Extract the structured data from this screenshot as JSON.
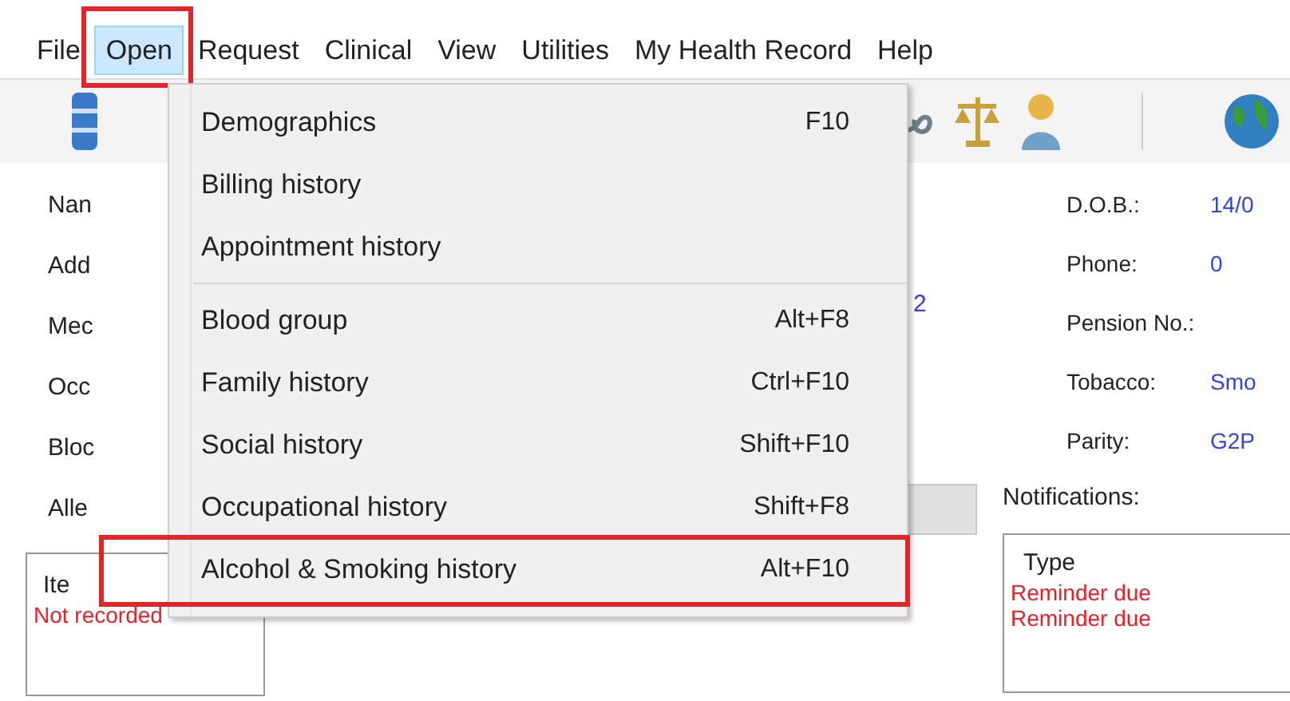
{
  "menu_bar": [
    {
      "label": "File",
      "selected": false,
      "highlighted": false
    },
    {
      "label": "Open",
      "selected": true,
      "highlighted": true
    },
    {
      "label": "Request",
      "selected": false,
      "highlighted": false
    },
    {
      "label": "Clinical",
      "selected": false,
      "highlighted": false
    },
    {
      "label": "View",
      "selected": false,
      "highlighted": false
    },
    {
      "label": "Utilities",
      "selected": false,
      "highlighted": false
    },
    {
      "label": "My Health Record",
      "selected": false,
      "highlighted": false
    },
    {
      "label": "Help",
      "selected": false,
      "highlighted": false
    }
  ],
  "open_menu": [
    {
      "kind": "item",
      "label": "Demographics",
      "shortcut": "F10",
      "highlighted": false
    },
    {
      "kind": "item",
      "label": "Billing history",
      "highlighted": false
    },
    {
      "kind": "item",
      "label": "Appointment history",
      "highlighted": false
    },
    {
      "kind": "separator"
    },
    {
      "kind": "item",
      "label": "Blood group",
      "shortcut": "Alt+F8",
      "highlighted": false
    },
    {
      "kind": "item",
      "label": "Family history",
      "shortcut": "Ctrl+F10",
      "highlighted": false
    },
    {
      "kind": "item",
      "label": "Social history",
      "shortcut": "Shift+F10",
      "highlighted": false
    },
    {
      "kind": "item",
      "label": "Occupational history",
      "shortcut": "Shift+F8",
      "highlighted": false
    },
    {
      "kind": "item",
      "label": "Alcohol & Smoking history",
      "shortcut": "Alt+F10",
      "highlighted": true
    }
  ],
  "left_labels": [
    "Nan",
    "Add",
    "Mec",
    "Occ",
    "Bloc",
    "Alle"
  ],
  "link_fragment": "2",
  "right_fields": [
    {
      "label": "D.O.B.:",
      "value": "14/0"
    },
    {
      "label": "Phone:",
      "value": "0"
    },
    {
      "label": "Pension No.:"
    },
    {
      "label": "Tobacco:",
      "value": "Smo"
    },
    {
      "label": "Parity:",
      "value": "G2P"
    }
  ],
  "allergies_table": {
    "header": "Ite",
    "rows": [
      "Not recorded"
    ]
  },
  "notifications": {
    "label": "Notifications:",
    "header": "Type",
    "rows": [
      "Reminder due",
      "Reminder due"
    ]
  }
}
